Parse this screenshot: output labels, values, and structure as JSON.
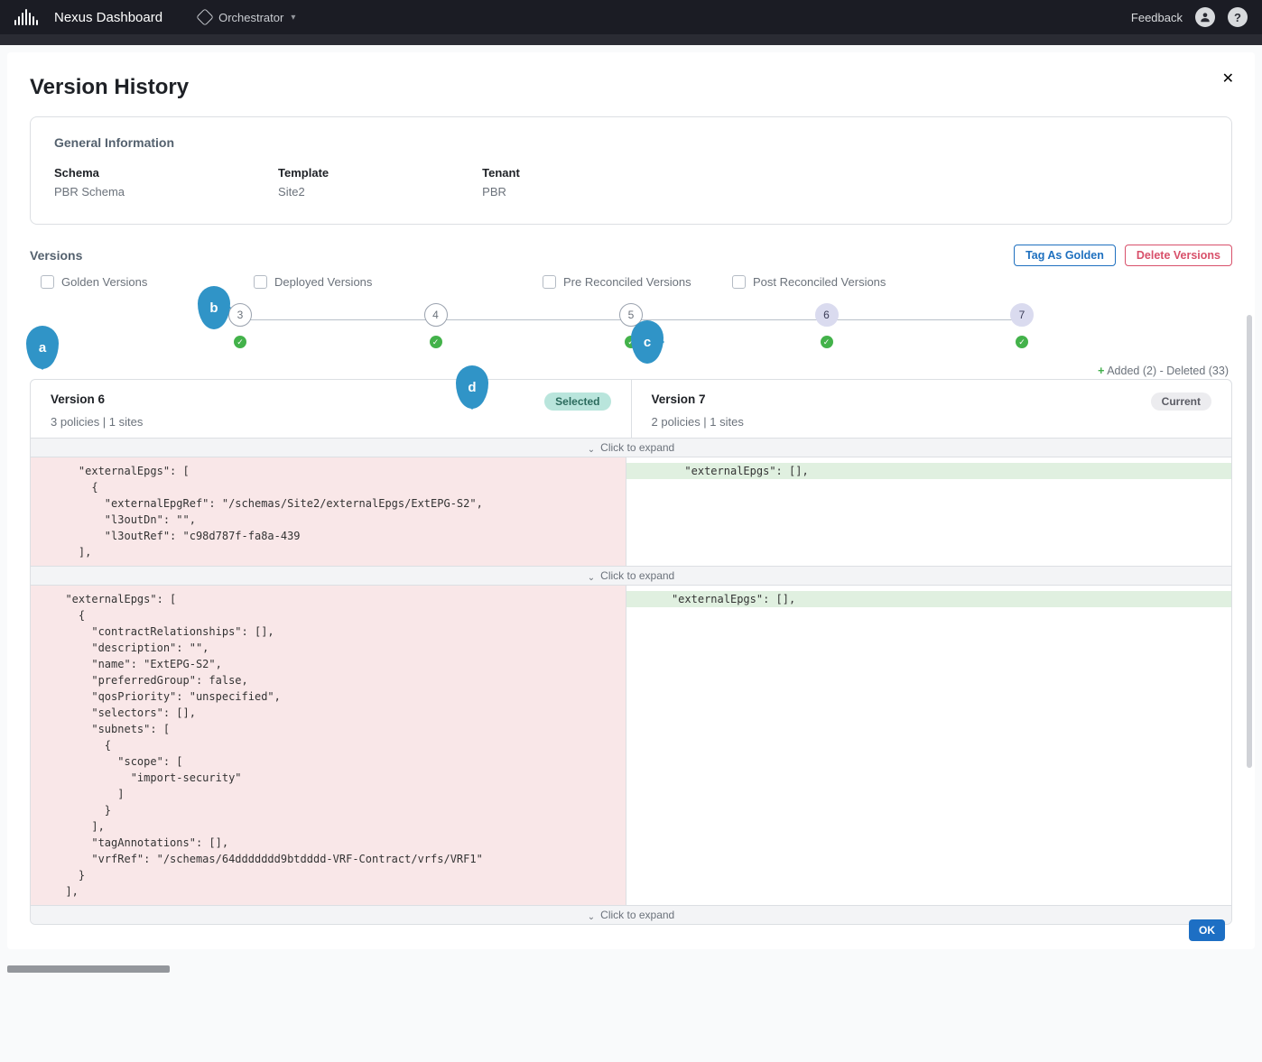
{
  "header": {
    "brand": "Nexus Dashboard",
    "orchestrator": "Orchestrator",
    "feedback": "Feedback",
    "help_glyph": "?"
  },
  "modal": {
    "title": "Version History",
    "close_glyph": "✕"
  },
  "general_info": {
    "heading": "General Information",
    "schema_label": "Schema",
    "schema_value": "PBR Schema",
    "template_label": "Template",
    "template_value": "Site2",
    "tenant_label": "Tenant",
    "tenant_value": "PBR"
  },
  "versions": {
    "heading": "Versions",
    "btn_tag": "Tag As Golden",
    "btn_delete": "Delete Versions",
    "filters": {
      "golden": "Golden Versions",
      "deployed": "Deployed Versions",
      "pre": "Pre Reconciled Versions",
      "post": "Post Reconciled Versions"
    },
    "nodes": [
      "3",
      "4",
      "5",
      "6",
      "7"
    ],
    "selected_node": "6",
    "current_node": "7"
  },
  "callouts": {
    "a": "a",
    "b": "b",
    "c": "c",
    "d": "d"
  },
  "legend": {
    "plus": "+",
    "text": " Added (2) - Deleted (33)"
  },
  "compare": {
    "left": {
      "title": "Version 6",
      "sub": "3 policies | 1 sites",
      "badge": "Selected"
    },
    "right": {
      "title": "Version 7",
      "sub": "2 policies | 1 sites",
      "badge": "Current"
    },
    "expand_label": "Click to expand"
  },
  "diff": {
    "block1_left": "    \"externalEpgs\": [\n      {\n        \"externalEpgRef\": \"/schemas/Site2/externalEpgs/ExtEPG-S2\",\n        \"l3outDn\": \"\",\n        \"l3outRef\": \"c98d787f-fa8a-439\n    ],",
    "block1_right_add": "    \"externalEpgs\": [],",
    "block2_left": "  \"externalEpgs\": [\n    {\n      \"contractRelationships\": [],\n      \"description\": \"\",\n      \"name\": \"ExtEPG-S2\",\n      \"preferredGroup\": false,\n      \"qosPriority\": \"unspecified\",\n      \"selectors\": [],\n      \"subnets\": [\n        {\n          \"scope\": [\n            \"import-security\"\n          ]\n        }\n      ],\n      \"tagAnnotations\": [],\n      \"vrfRef\": \"/schemas/64ddddddd9btdddd-VRF-Contract/vrfs/VRF1\"\n    }\n  ],",
    "block2_right_add": "  \"externalEpgs\": [],"
  },
  "footer": {
    "ok": "OK"
  }
}
